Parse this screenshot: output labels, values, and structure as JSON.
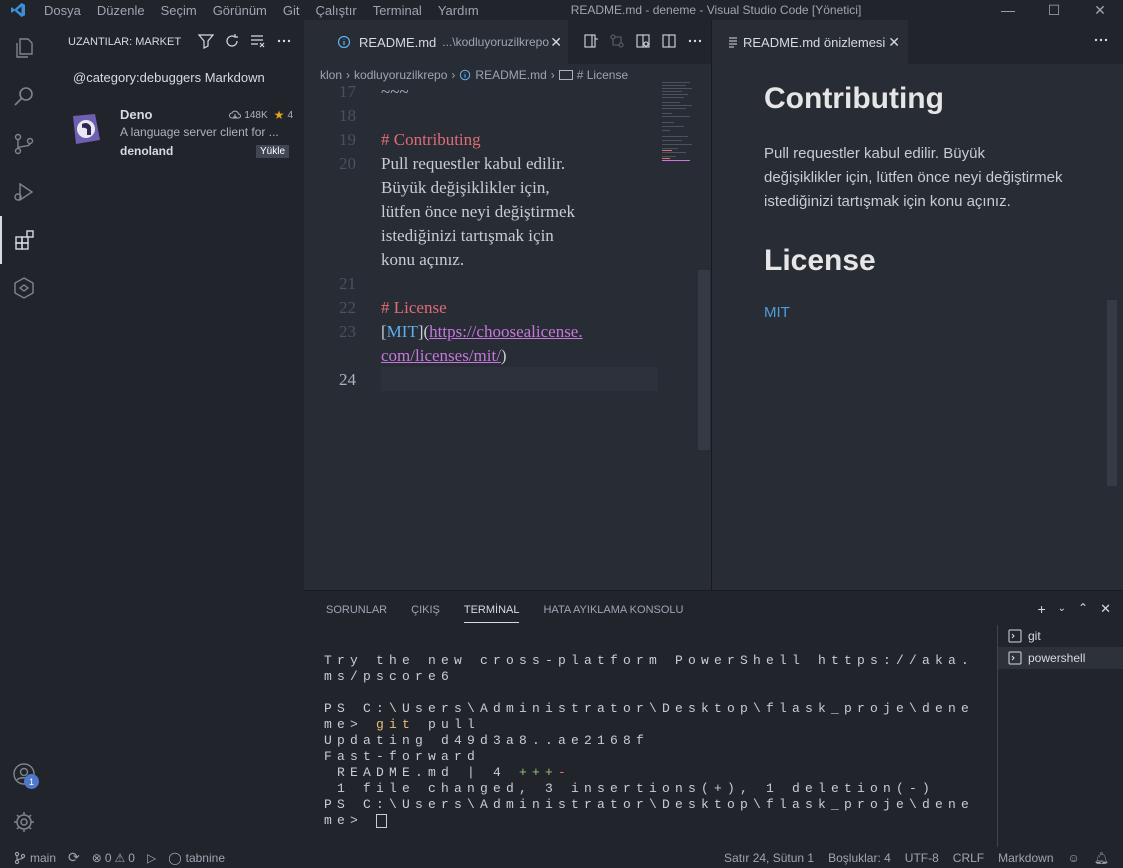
{
  "titlebar": {
    "menu": [
      "Dosya",
      "Düzenle",
      "Seçim",
      "Görünüm",
      "Git",
      "Çalıştır",
      "Terminal",
      "Yardım"
    ],
    "title": "README.md - deneme - Visual Studio Code [Yönetici]"
  },
  "sidebar": {
    "header": "UZANTILAR: MARKET",
    "search_value": "@category:debuggers Markdown",
    "extension": {
      "name": "Deno",
      "downloads": "148K",
      "rating": "4",
      "description": "A language server client for ...",
      "publisher": "denoland",
      "install_label": "Yükle"
    }
  },
  "editor": {
    "tab": {
      "name": "README.md",
      "desc": "...\\kodluyoruzilkrepo"
    },
    "breadcrumb": [
      "klon",
      "kodluyoruzilkrepo",
      "README.md",
      "# License"
    ],
    "lines": [
      {
        "n": "17",
        "text": "~~~"
      },
      {
        "n": "18",
        "text": ""
      },
      {
        "n": "19",
        "text": "# Contributing"
      },
      {
        "n": "20",
        "text": "Pull requestler kabul edilir."
      },
      {
        "n": "",
        "text": "Büyük değişiklikler için,"
      },
      {
        "n": "",
        "text": "lütfen önce neyi değiştirmek"
      },
      {
        "n": "",
        "text": "istediğinizi tartışmak için"
      },
      {
        "n": "",
        "text": "konu açınız."
      },
      {
        "n": "21",
        "text": ""
      },
      {
        "n": "22",
        "text": "# License"
      },
      {
        "n": "23",
        "link_text": "MIT",
        "url1": "https://choosealicense.",
        "url2": "com/licenses/mit/"
      },
      {
        "n": "24",
        "text": ""
      }
    ]
  },
  "preview": {
    "tab": "README.md önizlemesi",
    "h1": "Contributing",
    "p": "Pull requestler kabul edilir. Büyük değişiklikler için, lütfen önce neyi değiştirmek istediğinizi tartışmak için konu açınız.",
    "h2": "License",
    "link": "MIT"
  },
  "panel": {
    "tabs": [
      "SORUNLAR",
      "ÇIKIŞ",
      "TERMİNAL",
      "HATA AYIKLAMA KONSOLU"
    ],
    "active_tab": "TERMİNAL",
    "terminals": [
      "git",
      "powershell"
    ],
    "output": {
      "l1": "Try the new cross-platform PowerShell https://aka.",
      "l2": "ms/pscore6",
      "l3": "PS C:\\Users\\Administrator\\Desktop\\flask_proje\\dene",
      "l4a": "me> ",
      "l4b": "git",
      "l4c": " pull",
      "l5": "Updating d49d3a8..ae2168f",
      "l6": "Fast-forward",
      "l7a": " README.md | 4 ",
      "l7b": "+++",
      "l7c": "-",
      "l8": " 1 file changed, 3 insertions(+), 1 deletion(-)",
      "l9": "PS C:\\Users\\Administrator\\Desktop\\flask_proje\\dene",
      "l10": "me> "
    }
  },
  "statusbar": {
    "branch": "main",
    "errors": "0",
    "warnings": "0",
    "tabnine": "tabnine",
    "position": "Satır 24, Sütun 1",
    "spaces": "Boşluklar: 4",
    "encoding": "UTF-8",
    "eol": "CRLF",
    "language": "Markdown"
  },
  "accounts_badge": "1",
  "colors": {
    "accent": "#4d78cc",
    "heading": "#e06c75",
    "link": "#c678dd",
    "link_text": "#61afef"
  }
}
